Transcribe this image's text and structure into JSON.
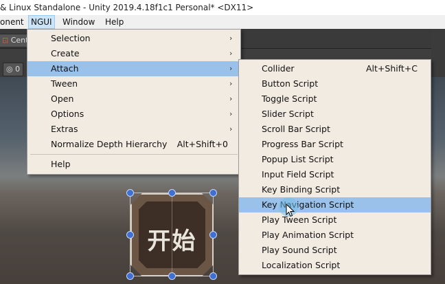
{
  "window": {
    "title": "& Linux Standalone - Unity 2019.4.18f1c1 Personal* <DX11>"
  },
  "menubar": {
    "items": [
      {
        "label": "onent"
      },
      {
        "label": "NGUI"
      },
      {
        "label": "Window"
      },
      {
        "label": "Help"
      }
    ]
  },
  "toolbar": {
    "center_label": "Cent",
    "vis_count": "0"
  },
  "ngui_menu": {
    "items": [
      {
        "label": "Selection",
        "shortcut": "",
        "arrow": "›"
      },
      {
        "label": "Create",
        "shortcut": "",
        "arrow": "›"
      },
      {
        "label": "Attach",
        "shortcut": "",
        "arrow": "›"
      },
      {
        "label": "Tween",
        "shortcut": "",
        "arrow": "›"
      },
      {
        "label": "Open",
        "shortcut": "",
        "arrow": "›"
      },
      {
        "label": "Options",
        "shortcut": "",
        "arrow": "›"
      },
      {
        "label": "Extras",
        "shortcut": "",
        "arrow": "›"
      },
      {
        "label": "Normalize Depth Hierarchy",
        "shortcut": "Alt+Shift+0",
        "arrow": ""
      },
      {
        "label": "Help",
        "shortcut": "",
        "arrow": ""
      }
    ]
  },
  "attach_menu": {
    "items": [
      {
        "label": "Collider",
        "shortcut": "Alt+Shift+C"
      },
      {
        "label": "Button Script",
        "shortcut": ""
      },
      {
        "label": "Toggle Script",
        "shortcut": ""
      },
      {
        "label": "Slider Script",
        "shortcut": ""
      },
      {
        "label": "Scroll Bar Script",
        "shortcut": ""
      },
      {
        "label": "Progress Bar Script",
        "shortcut": ""
      },
      {
        "label": "Popup List Script",
        "shortcut": ""
      },
      {
        "label": "Input Field Script",
        "shortcut": ""
      },
      {
        "label": "Key Binding Script",
        "shortcut": ""
      },
      {
        "label": "Key Navigation Script",
        "shortcut": ""
      },
      {
        "label": "Play Tween Script",
        "shortcut": ""
      },
      {
        "label": "Play Animation Script",
        "shortcut": ""
      },
      {
        "label": "Play Sound Script",
        "shortcut": ""
      },
      {
        "label": "Localization Script",
        "shortcut": ""
      }
    ]
  },
  "scene": {
    "button_label": "开始"
  },
  "colors": {
    "highlight": "#99c1ea",
    "menu_bg": "#f2ebe2",
    "handle": "#3f6fd0"
  },
  "icons": {
    "cursor": "arrow-cursor-icon",
    "eye": "eye-icon",
    "submenu": "chevron-right-icon"
  }
}
